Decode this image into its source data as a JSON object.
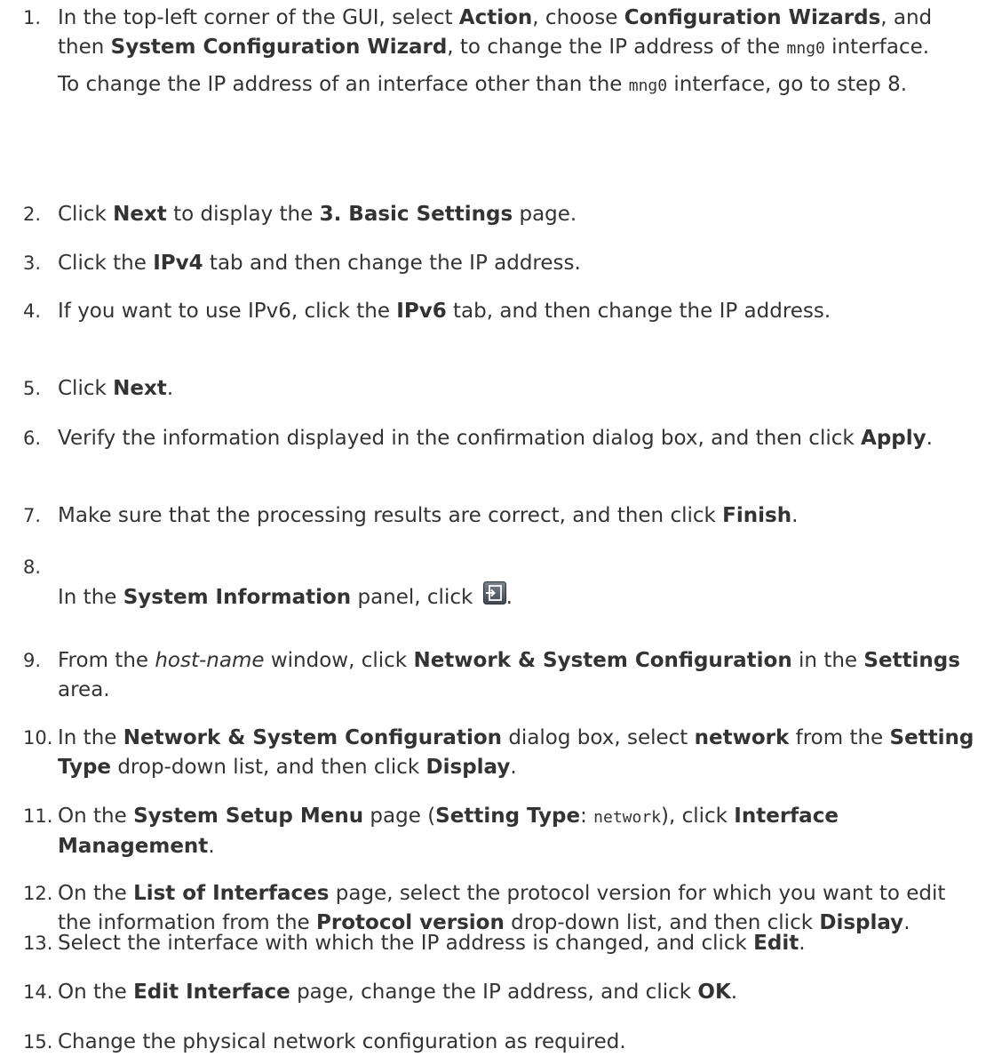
{
  "steps": [
    {
      "number": "1.",
      "paragraphs": [
        [
          {
            "t": "In the top-left corner of the GUI, select "
          },
          {
            "t": "Action",
            "s": "b"
          },
          {
            "t": ", choose "
          },
          {
            "t": "Configuration Wizards",
            "s": "b"
          },
          {
            "t": ", and then "
          },
          {
            "t": "System Configuration Wizard",
            "s": "b"
          },
          {
            "t": ", to change the IP address of the "
          },
          {
            "t": "mng0",
            "s": "code"
          },
          {
            "t": " interface."
          }
        ],
        [
          {
            "t": "To change the IP address of an interface other than the "
          },
          {
            "t": "mng0",
            "s": "code"
          },
          {
            "t": " interface, go to step 8."
          }
        ]
      ]
    },
    {
      "number": "2.",
      "paragraphs": [
        [
          {
            "t": "Click "
          },
          {
            "t": "Next",
            "s": "b"
          },
          {
            "t": " to display the "
          },
          {
            "t": "3. Basic Settings",
            "s": "b"
          },
          {
            "t": " page."
          }
        ]
      ]
    },
    {
      "number": "3.",
      "paragraphs": [
        [
          {
            "t": "Click the "
          },
          {
            "t": "IPv4",
            "s": "b"
          },
          {
            "t": " tab and then change the IP address."
          }
        ]
      ]
    },
    {
      "number": "4.",
      "paragraphs": [
        [
          {
            "t": "If you want to use IPv6, click the "
          },
          {
            "t": "IPv6",
            "s": "b"
          },
          {
            "t": " tab, and then change the IP address."
          }
        ]
      ]
    },
    {
      "number": "5.",
      "paragraphs": [
        [
          {
            "t": "Click "
          },
          {
            "t": "Next",
            "s": "b"
          },
          {
            "t": "."
          }
        ]
      ]
    },
    {
      "number": "6.",
      "paragraphs": [
        [
          {
            "t": "Verify the information displayed in the confirmation dialog box, and then click "
          },
          {
            "t": "Apply",
            "s": "b"
          },
          {
            "t": "."
          }
        ]
      ]
    },
    {
      "number": "7.",
      "paragraphs": [
        [
          {
            "t": "Make sure that the processing results are correct, and then click "
          },
          {
            "t": "Finish",
            "s": "b"
          },
          {
            "t": "."
          }
        ]
      ]
    },
    {
      "number": "8.",
      "paragraphs": [
        [
          {
            "t": "In the "
          },
          {
            "t": "System Information",
            "s": "b"
          },
          {
            "t": " panel, click "
          },
          {
            "icon": "exit-icon"
          },
          {
            "t": "."
          }
        ]
      ]
    },
    {
      "number": "9.",
      "paragraphs": [
        [
          {
            "t": "From the "
          },
          {
            "t": "host-name",
            "s": "i"
          },
          {
            "t": " window, click "
          },
          {
            "t": "Network & System Configuration",
            "s": "b"
          },
          {
            "t": " in the "
          },
          {
            "t": "Settings",
            "s": "b"
          },
          {
            "t": " area."
          }
        ]
      ]
    },
    {
      "number": "10.",
      "paragraphs": [
        [
          {
            "t": "In the "
          },
          {
            "t": "Network & System Configuration",
            "s": "b"
          },
          {
            "t": " dialog box, select "
          },
          {
            "t": "network",
            "s": "b"
          },
          {
            "t": " from the "
          },
          {
            "t": "Setting Type",
            "s": "b"
          },
          {
            "t": " drop-down list, and then click "
          },
          {
            "t": "Display",
            "s": "b"
          },
          {
            "t": "."
          }
        ]
      ]
    },
    {
      "number": "11.",
      "paragraphs": [
        [
          {
            "t": "On the "
          },
          {
            "t": "System Setup Menu",
            "s": "b"
          },
          {
            "t": " page ("
          },
          {
            "t": "Setting Type",
            "s": "b"
          },
          {
            "t": ": "
          },
          {
            "t": "network",
            "s": "code"
          },
          {
            "t": "), click "
          },
          {
            "t": "Interface Management",
            "s": "b"
          },
          {
            "t": "."
          }
        ]
      ]
    },
    {
      "number": "12.",
      "paragraphs": [
        [
          {
            "t": "On the "
          },
          {
            "t": "List of Interfaces",
            "s": "b"
          },
          {
            "t": " page, select the protocol version for which you want to edit the information from the "
          },
          {
            "t": "Protocol version",
            "s": "b"
          },
          {
            "t": " drop-down list, and then click "
          },
          {
            "t": "Display",
            "s": "b"
          },
          {
            "t": "."
          }
        ]
      ]
    },
    {
      "number": "13.",
      "paragraphs": [
        [
          {
            "t": "Select the interface with which the IP address is changed, and click "
          },
          {
            "t": "Edit",
            "s": "b"
          },
          {
            "t": "."
          }
        ]
      ]
    },
    {
      "number": "14.",
      "paragraphs": [
        [
          {
            "t": "On the "
          },
          {
            "t": "Edit Interface",
            "s": "b"
          },
          {
            "t": " page, change the IP address, and click "
          },
          {
            "t": "OK",
            "s": "b"
          },
          {
            "t": "."
          }
        ]
      ]
    },
    {
      "number": "15.",
      "paragraphs": [
        [
          {
            "t": "Change the physical network configuration as required."
          }
        ]
      ]
    }
  ]
}
